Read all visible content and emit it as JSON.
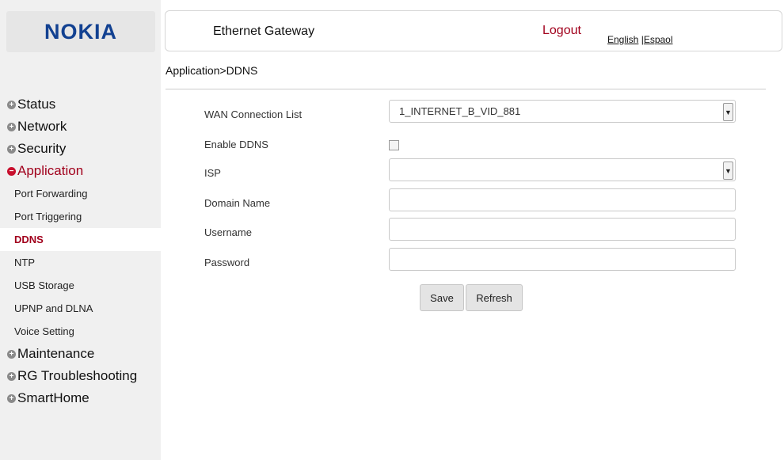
{
  "brand": {
    "logo_text": "NOKIA"
  },
  "header": {
    "title": "Ethernet Gateway",
    "logout": "Logout",
    "lang_english": "English",
    "lang_sep": " |",
    "lang_spanish": "Espaol"
  },
  "breadcrumb": "Application>DDNS",
  "sidebar": {
    "status": "Status",
    "network": "Network",
    "security": "Security",
    "application": "Application",
    "sub": [
      "Port Forwarding",
      "Port Triggering",
      "DDNS",
      "NTP",
      "USB Storage",
      "UPNP and DLNA",
      "Voice Setting"
    ],
    "maintenance": "Maintenance",
    "rg_troubleshooting": "RG Troubleshooting",
    "smarthome": "SmartHome"
  },
  "form": {
    "wan_label": "WAN Connection List",
    "wan_value": "1_INTERNET_B_VID_881",
    "enable_label": "Enable DDNS",
    "enable_checked": false,
    "isp_label": "ISP",
    "isp_value": "",
    "domain_label": "Domain Name",
    "domain_value": "",
    "username_label": "Username",
    "username_value": "",
    "password_label": "Password",
    "password_value": ""
  },
  "buttons": {
    "save": "Save",
    "refresh": "Refresh"
  },
  "colors": {
    "brand": "#124191",
    "accent": "#a1001c",
    "sidebar_bg": "#f0f0f0"
  }
}
